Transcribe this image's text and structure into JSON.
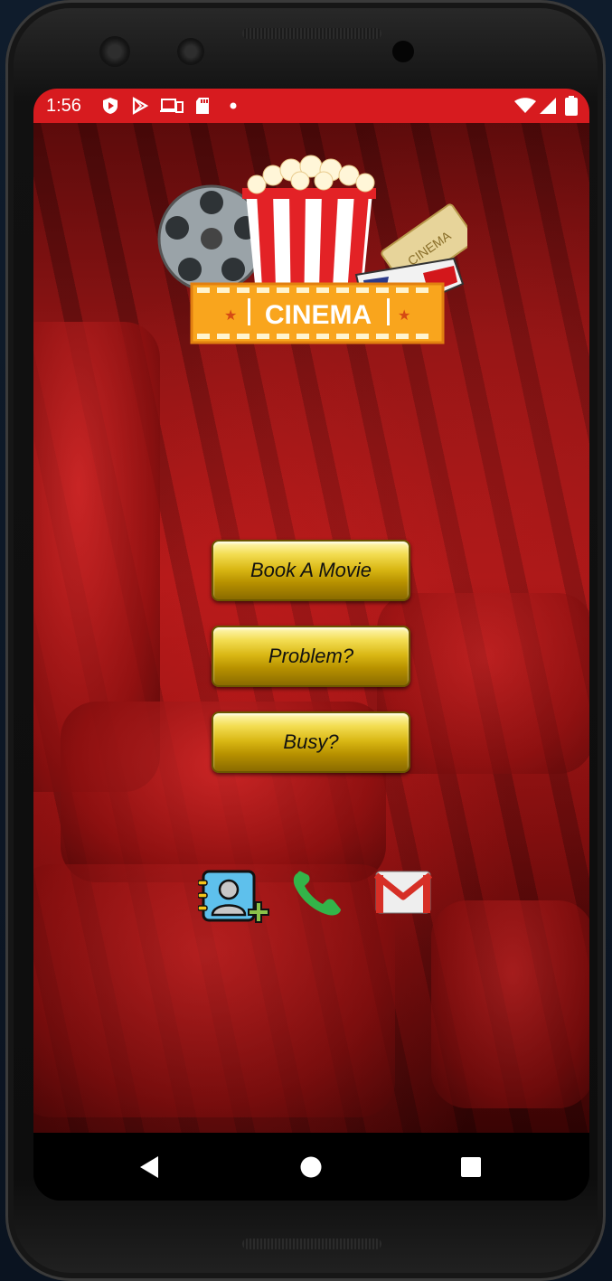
{
  "status_bar": {
    "time": "1:56",
    "icons": [
      "shield-icon",
      "play-store-icon",
      "cast-devices-icon",
      "sd-card-icon",
      "dot-icon",
      "wifi-icon",
      "signal-icon",
      "battery-icon"
    ],
    "color": "#d71b1f"
  },
  "header": {
    "logo_icon": "cinema-logo-icon"
  },
  "menu": {
    "book_label": "Book A Movie",
    "problem_label": "Problem?",
    "busy_label": "Busy?",
    "button_color": "#d9b714"
  },
  "contact_icons": [
    "add-contact-icon",
    "phone-icon",
    "gmail-icon"
  ],
  "nav_bar": {
    "buttons": [
      "back-icon",
      "home-icon",
      "recents-icon"
    ]
  }
}
